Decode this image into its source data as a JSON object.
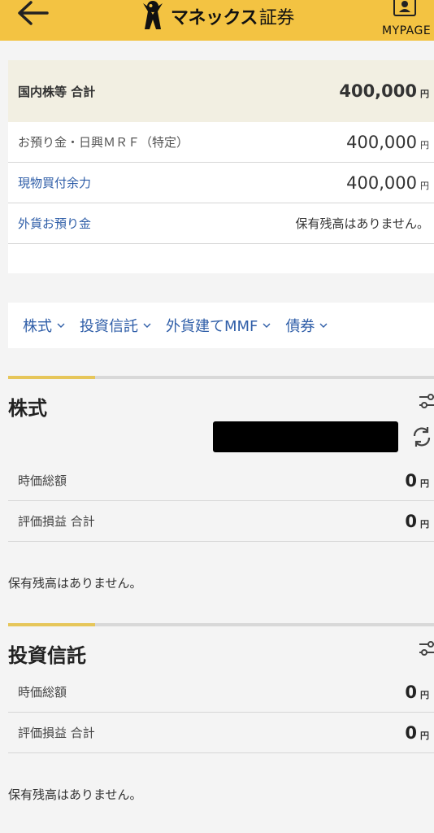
{
  "header": {
    "logo_brand": "マネックス",
    "logo_suffix": "証券",
    "mypage_label": "MYPAGE"
  },
  "summary": {
    "total_label": "国内株等 合計",
    "total_value": "400,000",
    "yen": "円",
    "rows": [
      {
        "label": "お預り金・日興ＭＲＦ（特定）",
        "value": "400,000"
      },
      {
        "label": "現物買付余力",
        "value": "400,000"
      }
    ],
    "fx_label": "外貨お預り金",
    "fx_value": "保有残高はありません。"
  },
  "tabs": [
    {
      "label": "株式"
    },
    {
      "label": "投資信託"
    },
    {
      "label": "外貨建てMMF"
    },
    {
      "label": "債券"
    }
  ],
  "stocks": {
    "title": "株式",
    "market_value_label": "時価総額",
    "market_value": "0",
    "pl_label": "評価損益 合計",
    "pl_value": "0",
    "no_holdings": "保有残高はありません。"
  },
  "funds": {
    "title": "投資信託",
    "market_value_label": "時価総額",
    "market_value": "0",
    "pl_label": "評価損益 合計",
    "pl_value": "0",
    "no_holdings": "保有残高はありません。"
  },
  "colors": {
    "header_bg": "#f3c342",
    "link": "#2f5ea8",
    "accent_bar": "#e6c65a"
  },
  "icons": {
    "back": "arrow-left-icon",
    "mascot": "mascot-logo-icon",
    "mypage": "user-icon",
    "filter": "sliders-icon",
    "refresh": "refresh-icon",
    "chevron": "chevron-down-icon"
  }
}
